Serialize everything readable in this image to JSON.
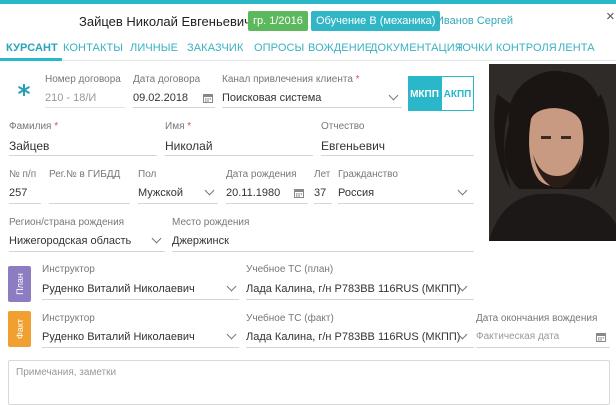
{
  "header": {
    "name": "Зайцев Николай Евгеньевич",
    "group_badge": "гр. 1/2016",
    "course_badge": "Обучение B (механика)",
    "instructor_link": "Иванов Сергей",
    "close_glyph": "×"
  },
  "tabs": [
    {
      "label": "КУРСАНТ",
      "active": true
    },
    {
      "label": "КОНТАКТЫ"
    },
    {
      "label": "ЛИЧНЫЕ"
    },
    {
      "label": "ЗАКАЗЧИК"
    },
    {
      "label": "ОПРОСЫ"
    },
    {
      "label": "ВОЖДЕНИЕ"
    },
    {
      "label": "ДОКУМЕНТАЦИЯ"
    },
    {
      "label": "ТОЧКИ КОНТРОЛЯ"
    },
    {
      "label": "ЛЕНТА"
    }
  ],
  "contract": {
    "number_label": "Номер договора",
    "number_value": "210 - 18/И",
    "date_label": "Дата договора",
    "date_value": "09.02.2018",
    "channel_label": "Канал привлечения клиента",
    "channel_value": "Поисковая система",
    "required_mark": "*"
  },
  "transmission": {
    "manual": "МКПП",
    "auto": "АКПП",
    "selected": "МКПП"
  },
  "name_fields": {
    "surname_label": "Фамилия",
    "surname_value": "Зайцев",
    "firstname_label": "Имя",
    "firstname_value": "Николай",
    "patronymic_label": "Отчество",
    "patronymic_value": "Евгеньевич"
  },
  "details": {
    "row_no_label": "№ п/п",
    "row_no_value": "257",
    "gibdd_label": "Рег.№ в ГИБДД",
    "gibdd_value": "",
    "sex_label": "Пол",
    "sex_value": "Мужской",
    "birth_label": "Дата рождения",
    "birth_value": "20.11.1980",
    "age_label": "Лет",
    "age_value": "37",
    "citizenship_label": "Гражданство",
    "citizenship_value": "Россия"
  },
  "birthplace": {
    "region_label": "Регион/страна рождения",
    "region_value": "Нижегородская область",
    "place_label": "Место рождения",
    "place_value": "Джержинск"
  },
  "plan": {
    "tag": "План",
    "instructor_label": "Инструктор",
    "instructor_value": "Руденко Виталий Николаевич",
    "vehicle_label": "Учебное ТС (план)",
    "vehicle_value": "Лада Калина, г/н Р783ВВ 116RUS (МКПП)"
  },
  "fact": {
    "tag": "Факт",
    "instructor_label": "Инструктор",
    "instructor_value": "Руденко Виталий Николаевич",
    "vehicle_label": "Учебное ТС (факт)",
    "vehicle_value": "Лада Калина, г/н Р783ВВ 116RUS (МКПП)",
    "end_label": "Дата окончания вождения",
    "end_placeholder": "Фактическая дата"
  },
  "notes": {
    "placeholder": "Примечания, заметки"
  },
  "colors": {
    "accent": "#2ab7c9",
    "green": "#5cb85c",
    "plan": "#8e7cc3",
    "fact": "#f0a030",
    "required": "#d9534f"
  }
}
